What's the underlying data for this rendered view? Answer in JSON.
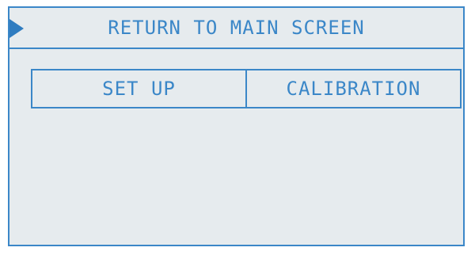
{
  "header": {
    "title": "RETURN TO MAIN SCREEN",
    "selector_icon": "triangle-right-icon"
  },
  "menu": {
    "items": [
      {
        "label": "SET UP"
      },
      {
        "label": "CALIBRATION"
      }
    ]
  },
  "colors": {
    "accent": "#3b87c8",
    "screen_background": "#e6ebee",
    "page_background": "#ffffff"
  }
}
